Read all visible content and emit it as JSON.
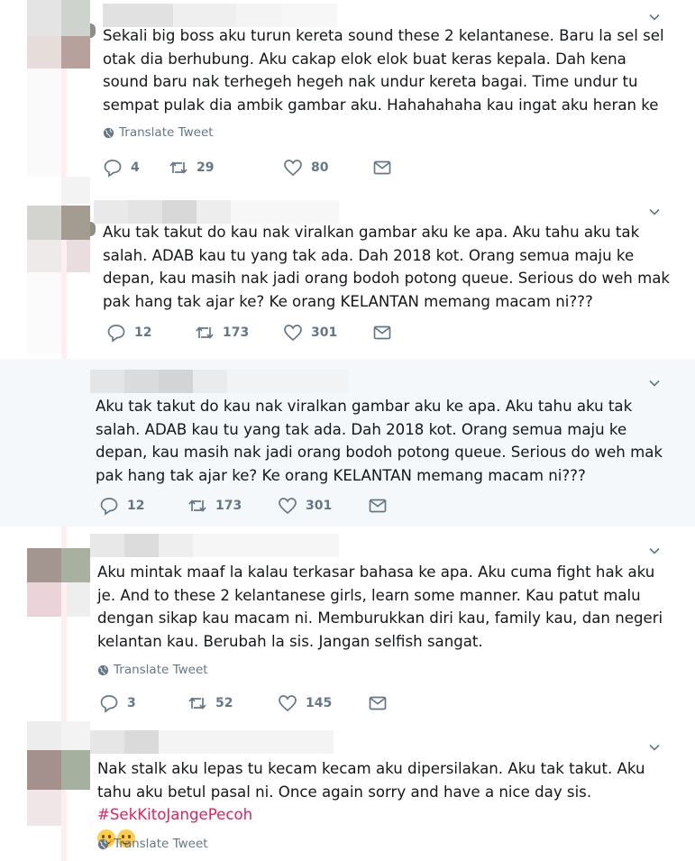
{
  "colors": {
    "text": "#14171a",
    "muted": "#657786",
    "hashtag": "#e0245e",
    "highlight_bg": "#f5f8fa"
  },
  "tweets": [
    {
      "text": "Sekali big boss aku turun kereta sound these 2 kelantanese. Baru la sel sel otak dia berhubung. Aku cakap elok elok buat keras kepala. Dah kena sound baru nak terhegeh hegeh nak undur kereta bagai. Time undur tu sempat pulak dia ambik gambar aku. Hahahahaha kau ingat aku heran ke",
      "translate": "Translate Tweet",
      "replies": "4",
      "retweets": "29",
      "likes": "80"
    },
    {
      "text": "Aku tak takut do kau nak viralkan gambar aku ke apa. Aku tahu aku tak salah. ADAB kau tu yang tak ada. Dah 2018 kot. Orang semua maju ke depan, kau masih nak jadi orang bodoh potong queue. Serious do weh mak pak hang tak ajar ke? Ke orang KELANTAN memang macam ni???",
      "replies": "12",
      "retweets": "173",
      "likes": "301"
    },
    {
      "text": "Aku tak takut do kau nak viralkan gambar aku ke apa. Aku tahu aku tak salah. ADAB kau tu yang tak ada. Dah 2018 kot. Orang semua maju ke depan, kau masih nak jadi orang bodoh potong queue. Serious do weh mak pak hang tak ajar ke? Ke orang KELANTAN memang macam ni???",
      "replies": "12",
      "retweets": "173",
      "likes": "301"
    },
    {
      "text": "Aku mintak maaf la kalau terkasar bahasa ke apa. Aku cuma fight hak aku je. And to these 2 kelantanese girls, learn some manner. Kau patut malu dengan sikap kau macam ni. Memburukkan diri kau, family kau, dan negeri kelantan kau. Berubah la sis. Jangan selfish sangat.",
      "translate": "Translate Tweet",
      "replies": "3",
      "retweets": "52",
      "likes": "145"
    },
    {
      "text": "Nak stalk aku lepas tu kecam kecam aku dipersilakan. Aku tak takut. Aku tahu aku betul pasal ni. Once again sorry and have a nice day sis.",
      "hashtag": "#SekKitoJangePecoh",
      "translate": "Translate Tweet"
    }
  ]
}
